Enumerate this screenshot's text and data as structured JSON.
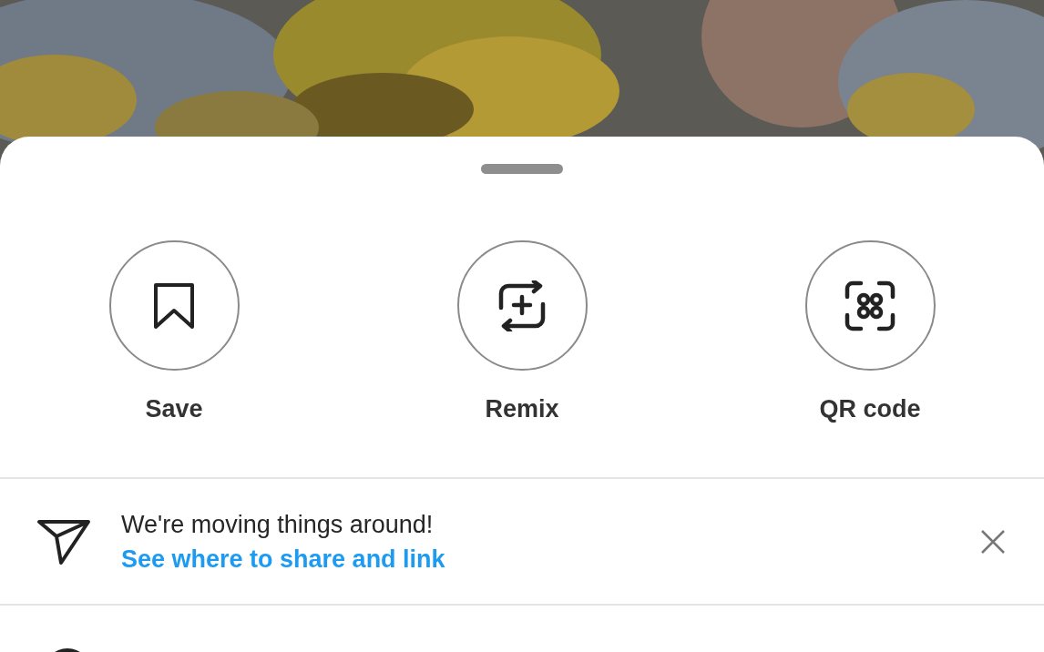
{
  "actions": [
    {
      "kind": "save",
      "label": "Save"
    },
    {
      "kind": "remix",
      "label": "Remix"
    },
    {
      "kind": "qr",
      "label": "QR code"
    }
  ],
  "notice": {
    "message": "We're moving things around!",
    "link": "See where to share and link"
  }
}
